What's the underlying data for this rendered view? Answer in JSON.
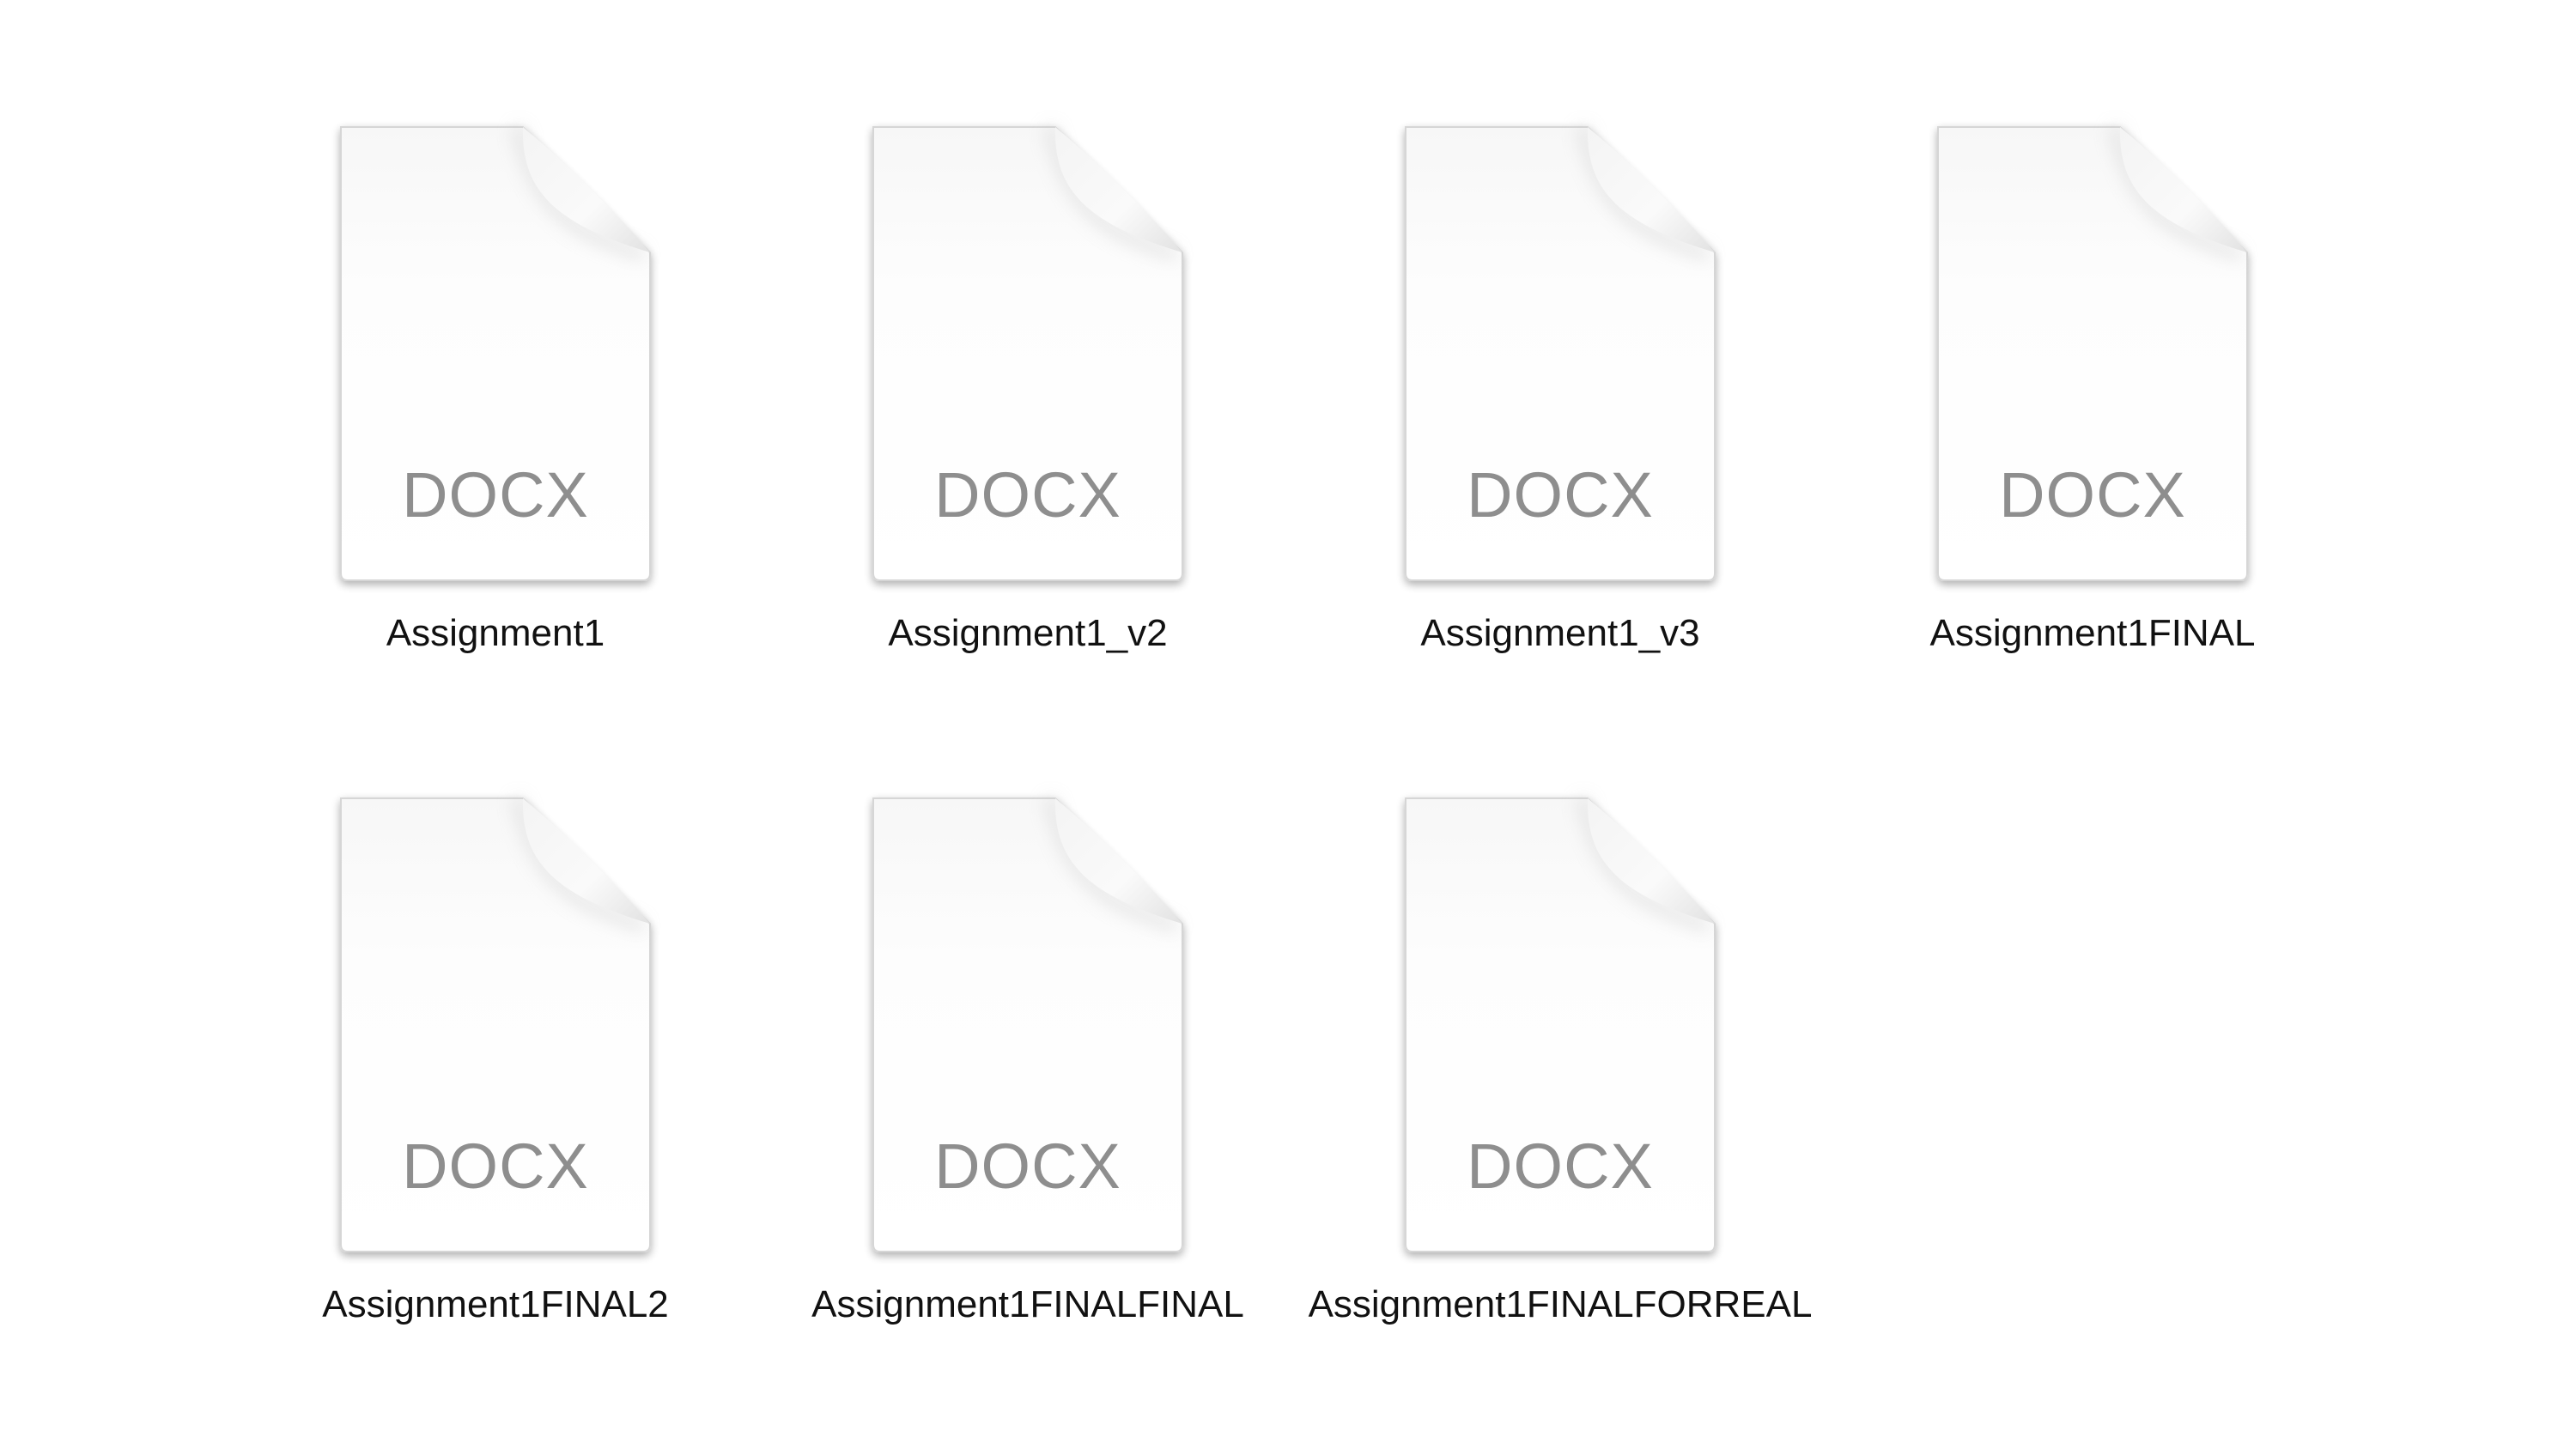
{
  "files": [
    {
      "name": "Assignment1",
      "ext": "DOCX"
    },
    {
      "name": "Assignment1_v2",
      "ext": "DOCX"
    },
    {
      "name": "Assignment1_v3",
      "ext": "DOCX"
    },
    {
      "name": "Assignment1FINAL",
      "ext": "DOCX"
    },
    {
      "name": "Assignment1FINAL2",
      "ext": "DOCX"
    },
    {
      "name": "Assignment1FINALFINAL",
      "ext": "DOCX"
    },
    {
      "name": "Assignment1FINALFORREAL",
      "ext": "DOCX"
    }
  ],
  "icon": "document-icon"
}
